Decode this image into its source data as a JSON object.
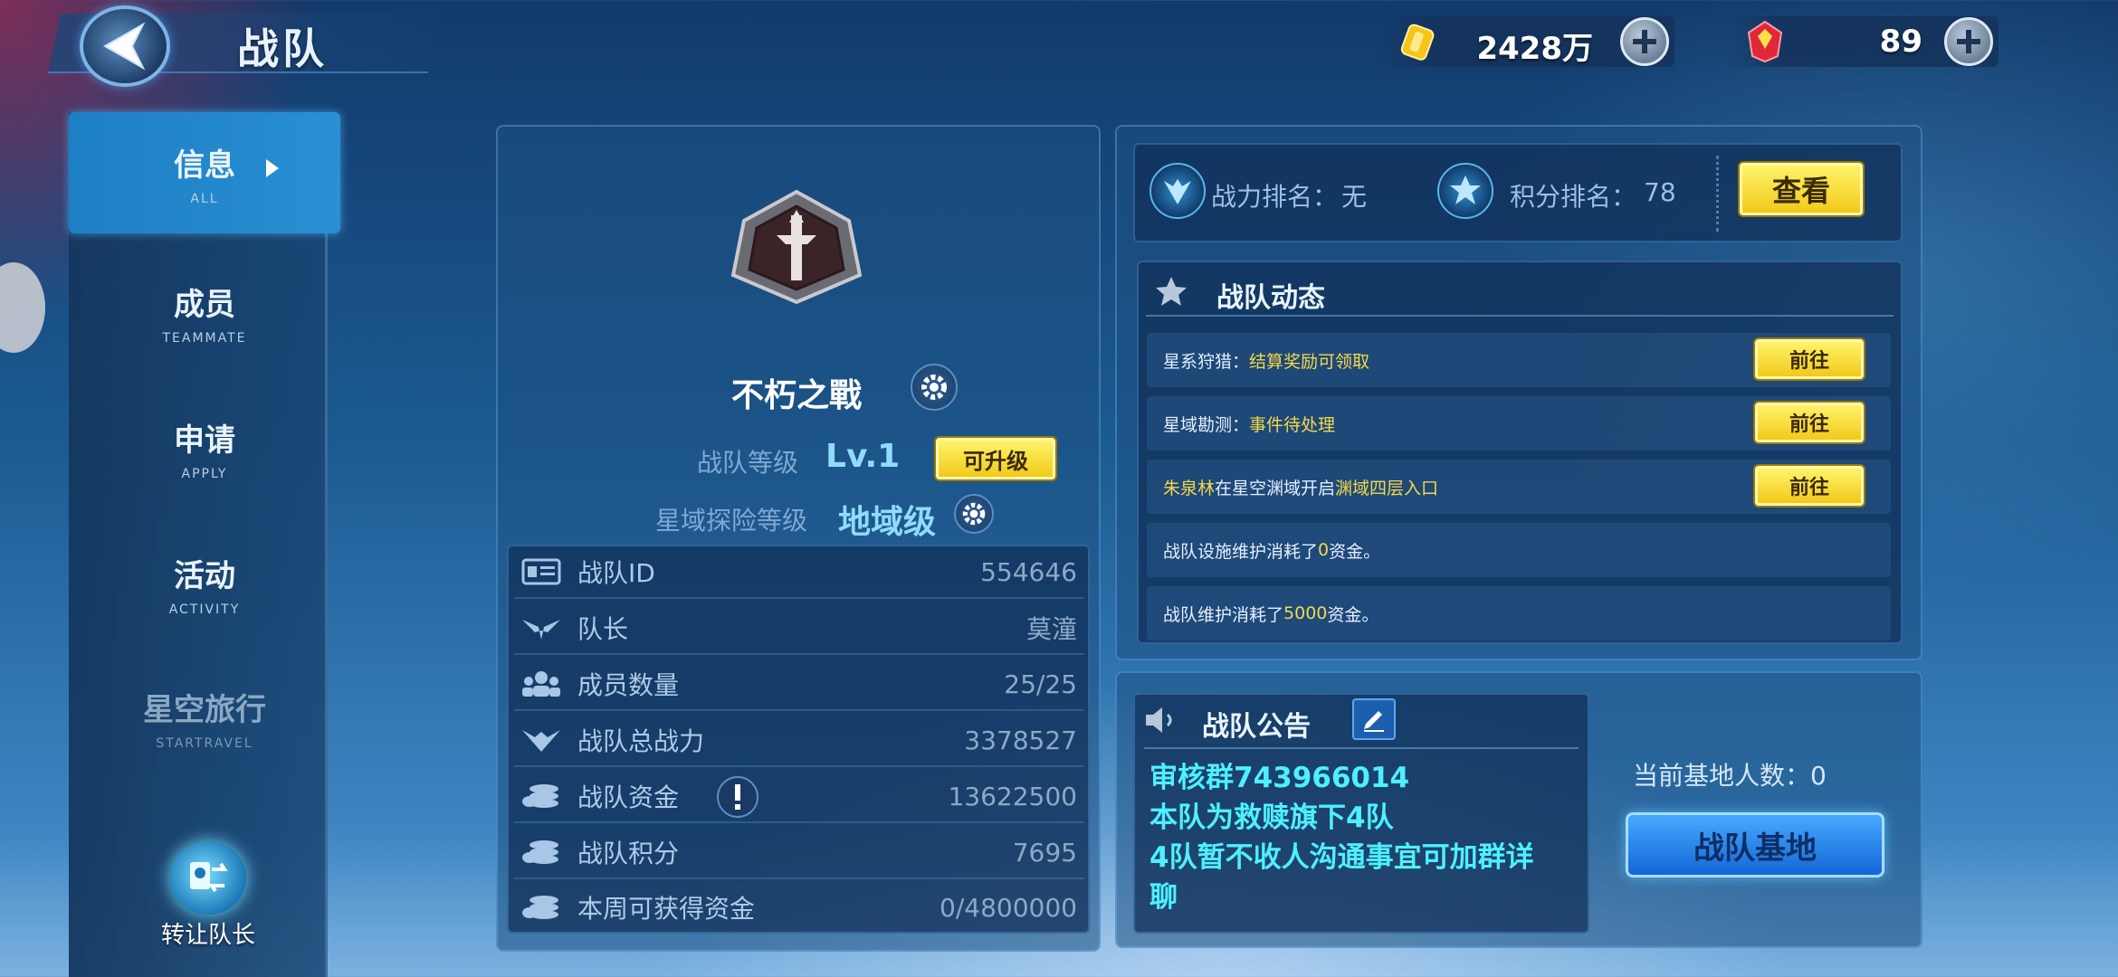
{
  "header": {
    "title": "战队"
  },
  "resources": {
    "gold": {
      "value": "2428万",
      "icon": "gold-coin-icon"
    },
    "gem": {
      "value": "89",
      "icon": "red-crystal-icon"
    }
  },
  "sidebar": {
    "items": [
      {
        "cn": "信息",
        "en": "ALL",
        "active": true
      },
      {
        "cn": "成员",
        "en": "TEAMMATE"
      },
      {
        "cn": "申请",
        "en": "APPLY"
      },
      {
        "cn": "活动",
        "en": "ACTIVITY"
      },
      {
        "cn": "星空旅行",
        "en": "STARTRAVEL",
        "disabled": true
      }
    ],
    "transfer_label": "转让队长"
  },
  "team": {
    "name": "不朽之戰",
    "level_label": "战队等级",
    "level_value": "Lv.1",
    "upgrade_label": "可升级",
    "explore_label": "星域探险等级",
    "explore_value": "地域级",
    "stats": [
      {
        "key": "战队ID",
        "value": "554646",
        "icon": "id-card-icon"
      },
      {
        "key": "队长",
        "value": "莫潼",
        "icon": "captain-wings-icon"
      },
      {
        "key": "成员数量",
        "value": "25/25",
        "icon": "members-icon"
      },
      {
        "key": "战队总战力",
        "value": "3378527",
        "icon": "power-wings-icon"
      },
      {
        "key": "战队资金",
        "value": "13622500",
        "icon": "coins-icon"
      },
      {
        "key": "战队积分",
        "value": "7695",
        "icon": "coins-icon"
      },
      {
        "key": "本周可获得资金",
        "value": "0/4800000",
        "icon": "coins-icon"
      }
    ]
  },
  "rank": {
    "power_label": "战力排名：",
    "power_value": "无",
    "score_label": "积分排名：",
    "score_value": "78",
    "view_button": "查看"
  },
  "dynamics": {
    "title": "战队动态",
    "go_label": "前往",
    "rows": [
      {
        "a": "星系狩猎：",
        "b": "结算奖励可领取"
      },
      {
        "a": "星域勘测：",
        "b": "事件待处理"
      },
      {
        "name": "朱泉林",
        "mid": "在星空渊域开启",
        "hl": "渊域四层入口"
      },
      {
        "a": "战队设施维护消耗了",
        "num": "0",
        "c": "资金。"
      },
      {
        "a": "战队维护消耗了",
        "num": "5000",
        "c": "资金。"
      }
    ]
  },
  "notice": {
    "title": "战队公告",
    "lines": [
      "审核群743966014",
      "本队为救赎旗下4队",
      "4队暂不收人沟通事宜可加群详",
      "聊"
    ]
  },
  "base": {
    "count_label": "当前基地人数：",
    "count_value": "0",
    "button": "战队基地"
  },
  "colors": {
    "accent_yellow": "#f2c91a",
    "accent_cyan": "#4df0ff",
    "highlight_text": "#f4d84a"
  }
}
